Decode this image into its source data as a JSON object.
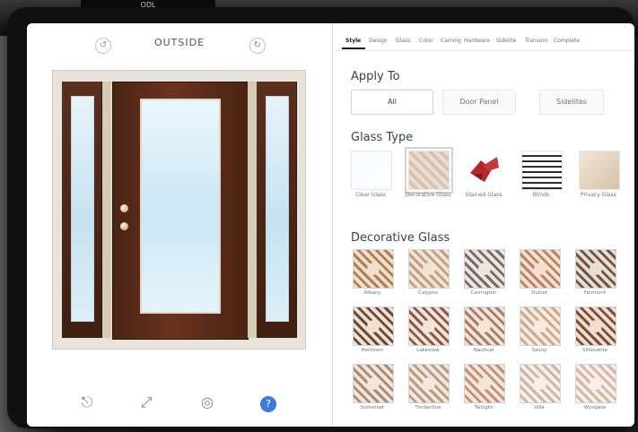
{
  "colors": {
    "accent_blue": "#3f7bd6",
    "door_wood_dark": "#4a2415",
    "door_wood_mid": "#6b3320",
    "glass_light": "#e6f3fa",
    "panel_text": "#374151",
    "muted_text": "#6b7280"
  },
  "background": {
    "banner_text": "ODL"
  },
  "left_panel": {
    "view_nav": {
      "prev_icon": "↺",
      "title": "OUTSIDE",
      "next_icon": "↻"
    },
    "toolbar": {
      "exit_icon": "⎋",
      "expand_icon": "⤢",
      "camera_icon": "◎",
      "help_icon": "?"
    }
  },
  "right_panel": {
    "tabs": [
      "Style",
      "Design",
      "Glass",
      "Color",
      "Caming",
      "Hardware",
      "Sidelite",
      "Transom",
      "Complete"
    ],
    "apply_to": {
      "title": "Apply To",
      "options": [
        "All",
        "Door Panel",
        "Sidelites"
      ]
    },
    "glass_type": {
      "title": "Glass Type",
      "items": [
        {
          "label": "Clear Glass",
          "icon": "clear-glass-icon"
        },
        {
          "label": "Decorative Glass",
          "icon": "decorative-glass-icon"
        },
        {
          "label": "Stained Glass",
          "icon": "stained-glass-icon"
        },
        {
          "label": "Blinds",
          "icon": "blinds-icon"
        },
        {
          "label": "Privacy Glass",
          "icon": "privacy-glass-icon"
        }
      ]
    },
    "decorative_glass": {
      "title": "Decorative Glass",
      "items": [
        {
          "label": "Albany",
          "color_a": "#f0dfca",
          "color_b": "#b07b57"
        },
        {
          "label": "Calypso",
          "color_a": "#f2e3d2",
          "color_b": "#bca188"
        },
        {
          "label": "Carrington",
          "color_a": "#efe6df",
          "color_b": "#7a6b6b"
        },
        {
          "label": "Dulcet",
          "color_a": "#f5e0cf",
          "color_b": "#b9826b"
        },
        {
          "label": "Fairmont",
          "color_a": "#e9dfd0",
          "color_b": "#6f5547"
        },
        {
          "label": "Heirloom",
          "color_a": "#f1e1d1",
          "color_b": "#6c4a3a"
        },
        {
          "label": "Lakeview",
          "color_a": "#f3e5d8",
          "color_b": "#8a5a4a"
        },
        {
          "label": "Nautical",
          "color_a": "#f2e5d8",
          "color_b": "#a77c69"
        },
        {
          "label": "Savoy",
          "color_a": "#f6eadf",
          "color_b": "#c9a98f"
        },
        {
          "label": "Silhouette",
          "color_a": "#f0dfd0",
          "color_b": "#7b4f3c"
        },
        {
          "label": "Somerset",
          "color_a": "#f1e6db",
          "color_b": "#a98a75"
        },
        {
          "label": "Timberline",
          "color_a": "#f3e7dc",
          "color_b": "#b89b86"
        },
        {
          "label": "Twilight",
          "color_a": "#f5e6da",
          "color_b": "#c2917b"
        },
        {
          "label": "Villa",
          "color_a": "#f7eee5",
          "color_b": "#c9b7a3"
        },
        {
          "label": "Wyngate",
          "color_a": "#f7efe8",
          "color_b": "#d0b8a5"
        }
      ]
    }
  }
}
